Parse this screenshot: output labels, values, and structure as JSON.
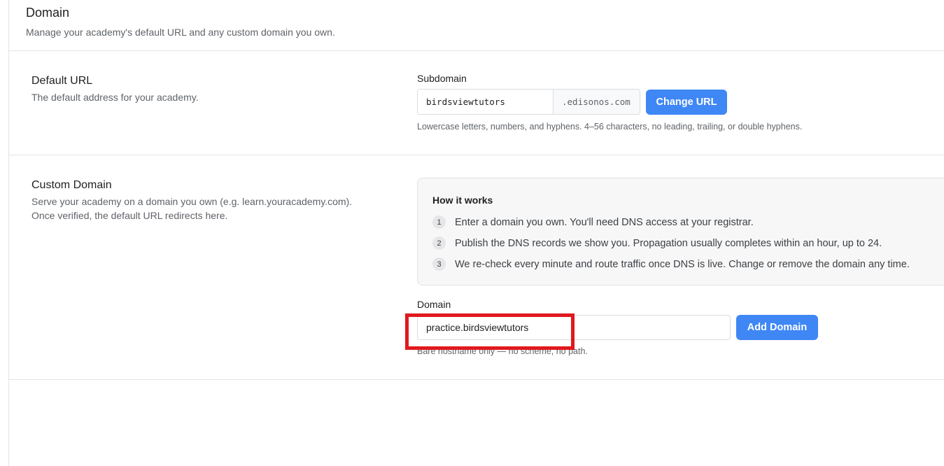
{
  "header": {
    "title": "Domain",
    "subtitle": "Manage your academy's default URL and any custom domain you own."
  },
  "default_url": {
    "title": "Default URL",
    "description": "The default address for your academy.",
    "field_label": "Subdomain",
    "subdomain_value": "birdsviewtutors",
    "suffix": ".edisonos.com",
    "button_label": "Change URL",
    "hint": "Lowercase letters, numbers, and hyphens. 4–56 characters, no leading, trailing, or double hyphens."
  },
  "custom_domain": {
    "title": "Custom Domain",
    "description_line1": "Serve your academy on a domain you own (e.g. learn.youracademy.com).",
    "description_line2": "Once verified, the default URL redirects here.",
    "how_it_works": {
      "title": "How it works",
      "steps": [
        {
          "number": "1",
          "text": "Enter a domain you own. You'll need DNS access at your registrar."
        },
        {
          "number": "2",
          "text": "Publish the DNS records we show you. Propagation usually completes within an hour, up to 24."
        },
        {
          "number": "3",
          "text": "We re-check every minute and route traffic once DNS is live. Change or remove the domain any time."
        }
      ]
    },
    "field_label": "Domain",
    "domain_value": "practice.birdsviewtutors",
    "button_label": "Add Domain",
    "hint": "Bare hostname only — no scheme, no path."
  },
  "colors": {
    "primary_button": "#3f87f5",
    "highlight_border": "#e0191e"
  }
}
